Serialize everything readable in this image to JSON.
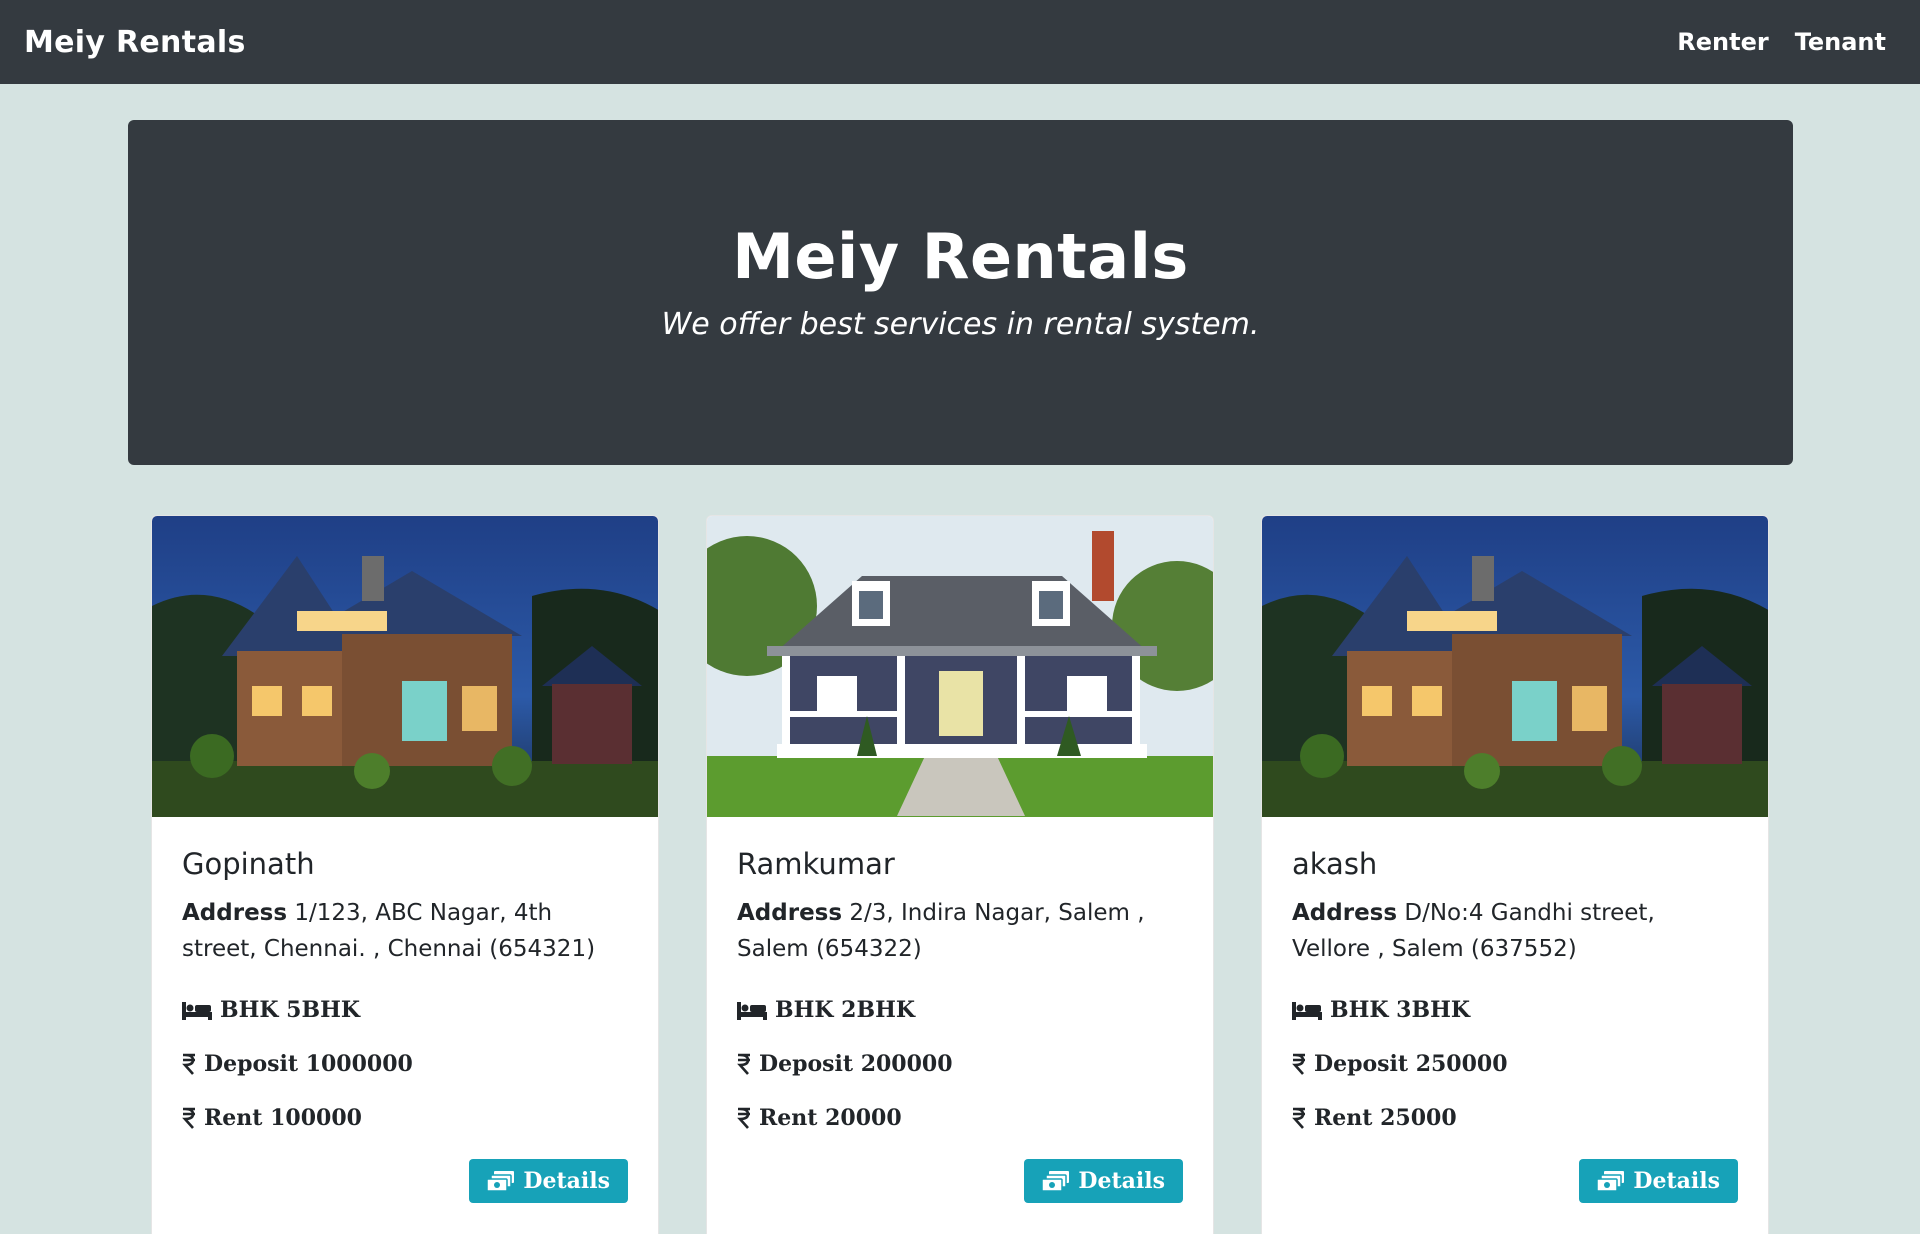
{
  "navbar": {
    "brand": "Meiy Rentals",
    "links": [
      "Renter",
      "Tenant"
    ]
  },
  "hero": {
    "title": "Meiy Rentals",
    "subtitle": "We offer best services in rental system."
  },
  "properties": [
    {
      "owner": "Gopinath",
      "address_label": "Address",
      "address": "1/123, ABC Nagar, 4th street, Chennai. , Chennai (654321)",
      "bhk": "BHK 5BHK",
      "deposit": "Deposit 1000000",
      "rent": "Rent 100000",
      "details_label": "Details",
      "image": "house-at-dusk-icon"
    },
    {
      "owner": "Ramkumar",
      "address_label": "Address",
      "address": "2/3, Indira Nagar, Salem , Salem (654322)",
      "bhk": "BHK 2BHK",
      "deposit": "Deposit 200000",
      "rent": "Rent 20000",
      "details_label": "Details",
      "image": "white-porch-house-icon"
    },
    {
      "owner": "akash",
      "address_label": "Address",
      "address": "D/No:4 Gandhi street, Vellore , Salem (637552)",
      "bhk": "BHK 3BHK",
      "deposit": "Deposit 250000",
      "rent": "Rent 25000",
      "details_label": "Details",
      "image": "house-at-dusk-icon"
    }
  ],
  "icons": {
    "bhk": "bed-icon",
    "money": "rupee-icon",
    "details": "money-bill-icon"
  },
  "colors": {
    "navbar": "#343a40",
    "background": "#d5e3e1",
    "button": "#17a2b8"
  }
}
